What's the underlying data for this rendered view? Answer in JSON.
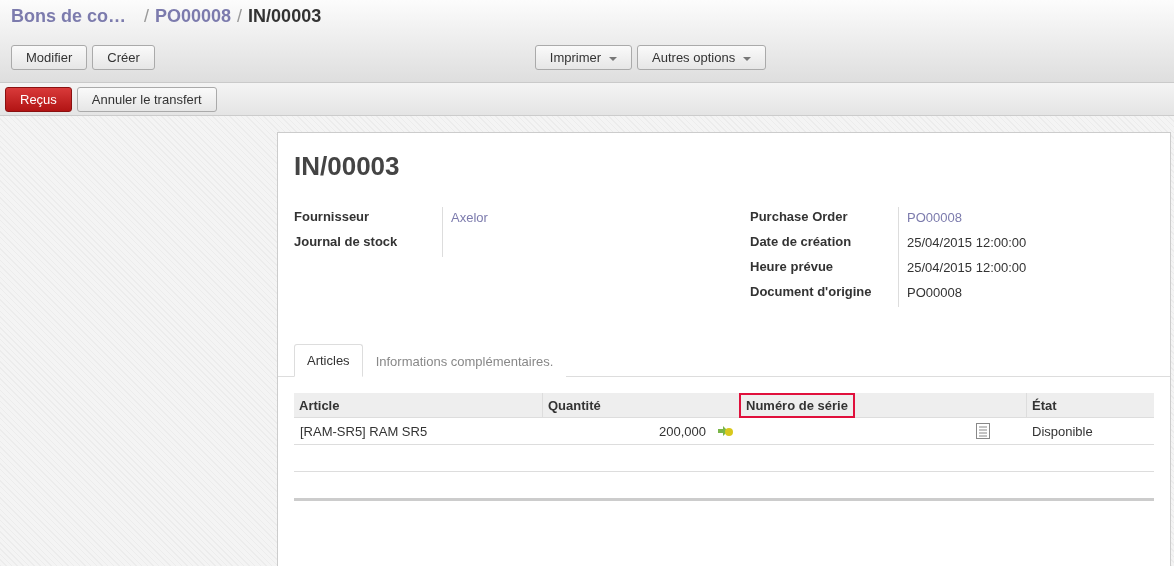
{
  "breadcrumb": [
    {
      "label": "Bons de co…",
      "kind": "link"
    },
    {
      "label": "PO00008",
      "kind": "link"
    },
    {
      "label": "IN/00003",
      "kind": "current"
    }
  ],
  "separator": "/",
  "toolbar": {
    "left_buttons": [
      "Modifier",
      "Créer"
    ],
    "dropdowns": [
      "Imprimer",
      "Autres options"
    ]
  },
  "status_bar": {
    "buttons": [
      {
        "label": "Reçus",
        "kind": "primary"
      },
      {
        "label": "Annuler le transfert",
        "kind": "default"
      }
    ]
  },
  "record": {
    "title": "IN/00003",
    "left_fields": [
      {
        "label": "Fournisseur",
        "value": "Axelor",
        "kind": "link"
      },
      {
        "label": "Journal de stock"
      }
    ],
    "right_fields": [
      {
        "label": "Purchase Order",
        "value": "PO00008",
        "kind": "link"
      },
      {
        "label": "Date de création",
        "value": "25/04/2015 12:00:00",
        "kind": "text"
      },
      {
        "label": "Heure prévue",
        "value": "25/04/2015 12:00:00",
        "kind": "text"
      },
      {
        "label": "Document d'origine",
        "value": "PO00008",
        "kind": "text"
      }
    ]
  },
  "tabs": [
    {
      "label": "Articles",
      "selected": true
    },
    {
      "label": "Informations complémentaires.",
      "selected": false
    }
  ],
  "table": {
    "columns": [
      {
        "label": "Article",
        "highlighted": false
      },
      {
        "label": "Quantité",
        "highlighted": false
      },
      {
        "label": "Numéro de série",
        "highlighted": true
      },
      {
        "label": "État",
        "highlighted": false
      }
    ],
    "rows": [
      {
        "article": "[RAM-SR5] RAM SR5",
        "quantity": "200,000",
        "state": "Disponible"
      }
    ]
  }
}
